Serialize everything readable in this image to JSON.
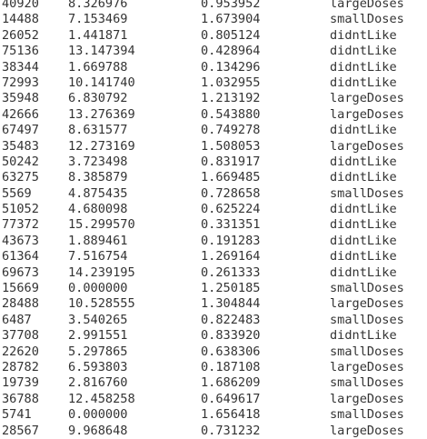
{
  "rows": [
    [
      "40920",
      "8.326976",
      "0.953952",
      "largeDoses"
    ],
    [
      "14488",
      "7.153469",
      "1.673904",
      "smallDoses"
    ],
    [
      "26052",
      "1.441871",
      "0.805124",
      "didntLike"
    ],
    [
      "75136",
      "13.147394",
      "0.428964",
      "didntLike"
    ],
    [
      "38344",
      "1.669788",
      "0.134296",
      "didntLike"
    ],
    [
      "72993",
      "10.141740",
      "1.032955",
      "didntLike"
    ],
    [
      "35948",
      "6.830792",
      "1.213192",
      "largeDoses"
    ],
    [
      "42666",
      "13.276369",
      "0.543880",
      "largeDoses"
    ],
    [
      "67497",
      "8.631577",
      "0.749278",
      "didntLike"
    ],
    [
      "35483",
      "12.273169",
      "1.508053",
      "largeDoses"
    ],
    [
      "50242",
      "3.723498",
      "0.831917",
      "didntLike"
    ],
    [
      "63275",
      "8.385879",
      "1.669485",
      "didntLike"
    ],
    [
      "5569",
      "4.875435",
      "0.728658",
      "smallDoses"
    ],
    [
      "51052",
      "4.680098",
      "0.625224",
      "didntLike"
    ],
    [
      "77372",
      "15.299570",
      "0.331351",
      "didntLike"
    ],
    [
      "43673",
      "1.889461",
      "0.191283",
      "didntLike"
    ],
    [
      "61364",
      "7.516754",
      "1.269164",
      "didntLike"
    ],
    [
      "69673",
      "14.239195",
      "0.261333",
      "didntLike"
    ],
    [
      "15669",
      "0.000000",
      "1.250185",
      "smallDoses"
    ],
    [
      "28488",
      "10.528555",
      "1.304844",
      "largeDoses"
    ],
    [
      "6487",
      "3.540265",
      "0.822483",
      "smallDoses"
    ],
    [
      "37708",
      "2.991551",
      "0.833920",
      "didntLike"
    ],
    [
      "22620",
      "5.297865",
      "0.638306",
      "smallDoses"
    ],
    [
      "28782",
      "6.593803",
      "0.187108",
      "largeDoses"
    ],
    [
      "19739",
      "2.816760",
      "1.686209",
      "smallDoses"
    ],
    [
      "36788",
      "12.458258",
      "0.649617",
      "largeDoses"
    ],
    [
      "5741",
      "0.000000",
      "1.656418",
      "smallDoses"
    ],
    [
      "28567",
      "9.968648",
      "0.731232",
      "largeDoses"
    ]
  ]
}
